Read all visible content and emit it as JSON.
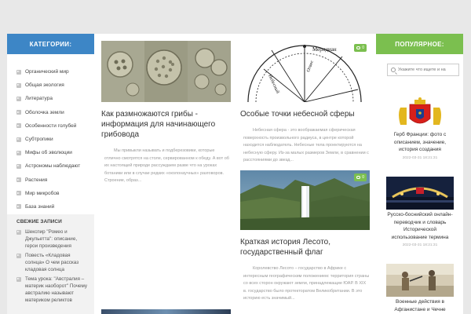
{
  "categories": {
    "title": "КАТЕГОРИИ:",
    "items": [
      "Органический мир",
      "Общая экология",
      "Литература",
      "Оболочка земли",
      "Особенности голубей",
      "Субтропики",
      "Мифы об эволюции",
      "Астрономы наблюдают",
      "Растения",
      "Мир микробов",
      "База знаний"
    ]
  },
  "recent": {
    "title": "СВЕЖИЕ ЗАПИСИ",
    "items": [
      "Шекспир \"Ромео и Джульетта\": описание, герои произведения",
      "Повесть «Кладовая солнца» О чем рассказ кладовая солнца",
      "Тема урока: \"Австралия – материк наоборот\" Почему австралию называют материком реликтов"
    ]
  },
  "posts": [
    {
      "title": "Как размножаются грибы - информация для начинающего грибовода",
      "excerpt": "Мы привыкли называть и подберезовики, которые отлично смотрятся на столе, сервированном к обеду. А вот об их настоящей природе рассуждаем разве что на уроках ботаники или в случае редких «околонаучных» разговоров. Строение, образ...",
      "comments": "0"
    },
    {
      "title": "Особые точки небесной сферы",
      "excerpt": "Небесная сфера - это воображаемая сферическая поверхность произвольного радиуса, в центре которой находится наблюдатель. Небесные тела проектируются на небесную сферу. Из-за малых размеров Земли, в сравнении с расстояниями до звезд...",
      "comments": "0",
      "diagram_labels": {
        "meridian": "Меридиан",
        "plumb": "Отвес",
        "sky": "Небесный"
      }
    },
    {
      "title": "Краткая история Лесото, государственный флаг",
      "excerpt": "Королевство Лесото – государство в Африке с интересным географическим положением: территория страны со всех сторон окружают земли, принадлежащие ЮАР. В XIX в. государство было протекторатом Великобритании. В это историю есть значимый...",
      "comments": "0"
    }
  ],
  "popular": {
    "title": "ПОПУЛЯРНОЕ:",
    "search_placeholder": "Укажите что ищете и на",
    "items": [
      {
        "title": "Герб Франции: фото с описанием, значение, история создания",
        "date": "2022-03-31 18:21:31"
      },
      {
        "title": "Русско-боснийский онлайн-переводчик и словарь Исторической использование термина",
        "date": "2022-03-31 18:21:31"
      },
      {
        "title": "Военные действия в Афганистане и Чечне",
        "date": ""
      }
    ]
  },
  "colors": {
    "category_header": "#3d86c6",
    "popular_header": "#7bbf4f",
    "badge": "#7bbf4f"
  }
}
